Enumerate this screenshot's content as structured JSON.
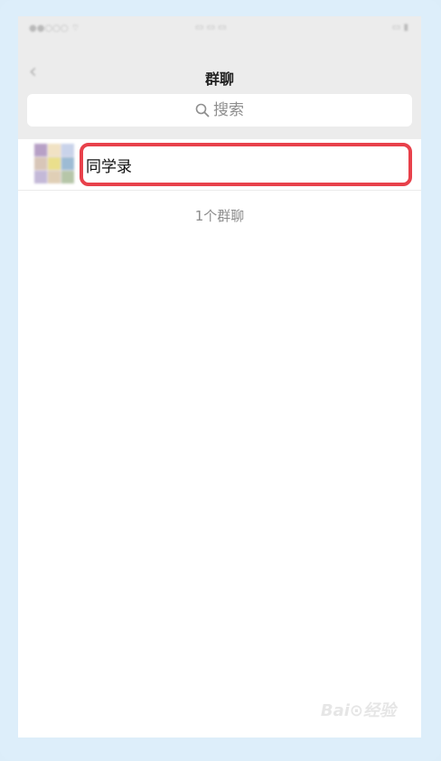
{
  "nav": {
    "title": "群聊",
    "back_icon": "chevron-left-icon"
  },
  "search": {
    "placeholder": "搜索",
    "icon": "search-icon"
  },
  "groups": [
    {
      "name": "同学录",
      "avatar_icon": "group-avatar-grid"
    }
  ],
  "footer": {
    "count_text": "1个群聊"
  },
  "colors": {
    "highlight": "#e8414b",
    "header_bg": "#ececec",
    "outer_bg": "#ddeefa"
  }
}
